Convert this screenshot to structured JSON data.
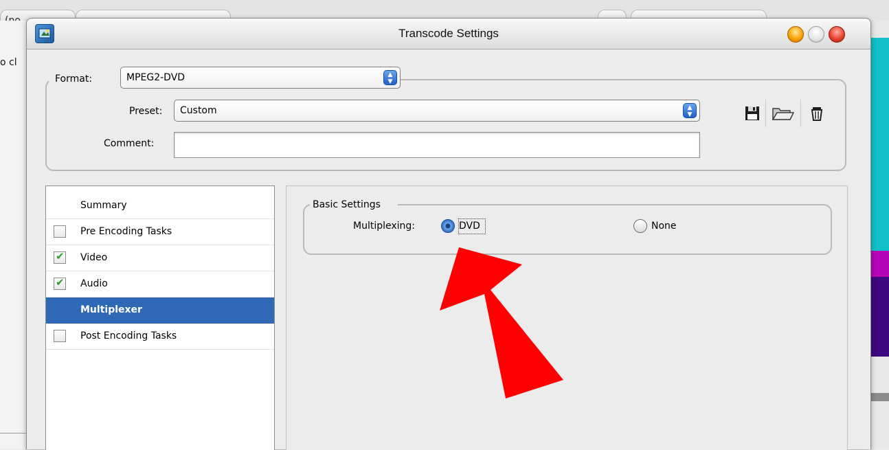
{
  "background": {
    "tab1_text": "(no",
    "left_text": "o cl",
    "stripe_colors": [
      "#12c0c7",
      "#b606b8",
      "#3d0880"
    ]
  },
  "window": {
    "title": "Transcode Settings",
    "app_icon": "app-icon",
    "traffic_lights": {
      "minimize": "#f8a300",
      "zoom": "#e4e4e4",
      "close": "#e8452f"
    }
  },
  "format": {
    "label": "Format:",
    "value": "MPEG2-DVD",
    "preset_label": "Preset:",
    "preset_value": "Custom",
    "comment_label": "Comment:",
    "comment_value": "",
    "tools": [
      "save-icon",
      "open-folder-icon",
      "trash-icon"
    ]
  },
  "sidebar": {
    "items": [
      {
        "label": "Summary",
        "checkbox": null,
        "selected": false
      },
      {
        "label": "Pre Encoding Tasks",
        "checkbox": false,
        "selected": false
      },
      {
        "label": "Video",
        "checkbox": true,
        "selected": false
      },
      {
        "label": "Audio",
        "checkbox": true,
        "selected": false
      },
      {
        "label": "Multiplexer",
        "checkbox": null,
        "selected": true
      },
      {
        "label": "Post Encoding Tasks",
        "checkbox": false,
        "selected": false
      }
    ]
  },
  "basic_settings": {
    "group_label": "Basic Settings",
    "multiplexing_label": "Multiplexing:",
    "options": [
      {
        "label": "DVD",
        "selected": true
      },
      {
        "label": "None",
        "selected": false
      }
    ]
  },
  "annotation": {
    "arrow_color": "#ff0000"
  }
}
